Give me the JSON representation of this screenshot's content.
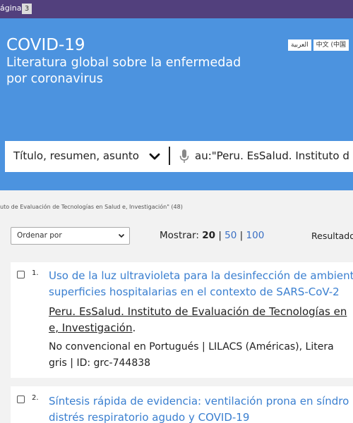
{
  "topbar": {
    "page_label": "ágina",
    "page_number": "3"
  },
  "hero": {
    "title": "COVID-19",
    "subtitle_line1": "Literatura global sobre la enfermedad",
    "subtitle_line2": "por coronavirus",
    "languages": [
      "العربية",
      "中文 (中国"
    ]
  },
  "search": {
    "field": "Título, resumen, asunto",
    "query": "au:\"Peru. EsSalud. Instituto d"
  },
  "breadcrumb": "uto de Evaluación de Tecnologías en Salud e, Investigación\" (48)",
  "controls": {
    "sort_label": "Ordenar por",
    "show_label": "Mostrar:",
    "show_options": [
      "20",
      "50",
      "100"
    ],
    "results_label": "Resultado"
  },
  "results": [
    {
      "number": "1.",
      "title_line1": "Uso de la luz ultravioleta para la desinfección de ambient",
      "title_line2": "superficies hospitalarias en el contexto de SARS-CoV-2",
      "author_line1": "Peru. EsSalud. Instituto de Evaluación de Tecnologías en",
      "author_line2": "e, Investigación",
      "author_suffix": ".",
      "meta_line1": "No convencional en Portugués | LILACS (Américas), Litera",
      "meta_line2": "gris | ID: grc-744838"
    },
    {
      "number": "2.",
      "title_line1": "Síntesis rápida de evidencia: ventilación prona en síndro",
      "title_line2": "distrés respiratorio agudo y COVID-19"
    }
  ]
}
